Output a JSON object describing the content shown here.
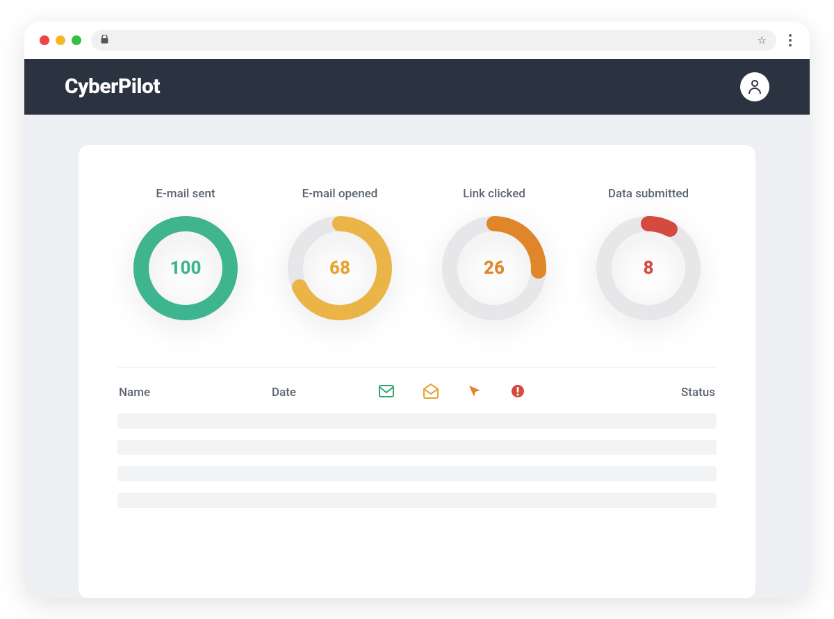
{
  "header": {
    "brand": "CyberPilot"
  },
  "metrics": [
    {
      "label": "E-mail sent",
      "value": 100,
      "color": "#3eb48f",
      "value_class": "c-green"
    },
    {
      "label": "E-mail opened",
      "value": 68,
      "color": "#eab446",
      "value_class": "c-orange"
    },
    {
      "label": "Link clicked",
      "value": 26,
      "color": "#e0862a",
      "value_class": "c-dorange"
    },
    {
      "label": "Data submitted",
      "value": 8,
      "color": "#d44a3f",
      "value_class": "c-red"
    }
  ],
  "table": {
    "columns": {
      "name": "Name",
      "date": "Date",
      "status": "Status"
    },
    "icon_columns": [
      "mail-sent-icon",
      "mail-opened-icon",
      "click-icon",
      "alert-icon"
    ]
  },
  "chart_data": [
    {
      "type": "pie",
      "title": "E-mail sent",
      "series": [
        {
          "name": "count",
          "values": [
            100
          ]
        }
      ],
      "max": 100
    },
    {
      "type": "pie",
      "title": "E-mail opened",
      "series": [
        {
          "name": "count",
          "values": [
            68
          ]
        }
      ],
      "max": 100
    },
    {
      "type": "pie",
      "title": "Link clicked",
      "series": [
        {
          "name": "count",
          "values": [
            26
          ]
        }
      ],
      "max": 100
    },
    {
      "type": "pie",
      "title": "Data submitted",
      "series": [
        {
          "name": "count",
          "values": [
            8
          ]
        }
      ],
      "max": 100
    }
  ]
}
